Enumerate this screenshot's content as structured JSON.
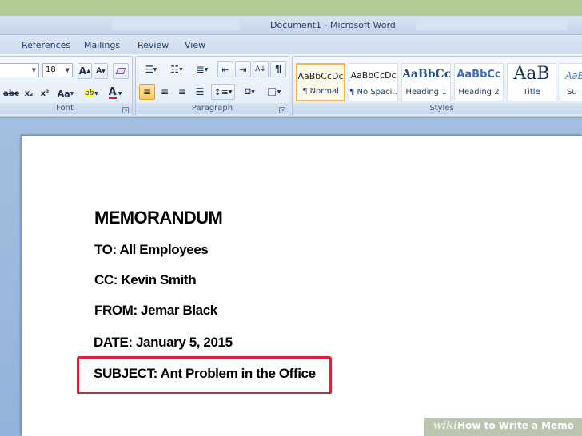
{
  "window": {
    "title": "Document1 - Microsoft Word"
  },
  "tabs": [
    "References",
    "Mailings",
    "Review",
    "View"
  ],
  "ribbon": {
    "font": {
      "size_value": "18",
      "grow_label": "A",
      "shrink_label": "A",
      "strike_label": "abc",
      "subscript_label": "x₂",
      "superscript_label": "x²",
      "case_label": "Aa",
      "highlight_label": "ab",
      "color_label": "A",
      "group_label": "Font"
    },
    "paragraph": {
      "group_label": "Paragraph",
      "pilcrow": "¶"
    },
    "styles": {
      "group_label": "Styles",
      "items": [
        {
          "preview": "AaBbCcDc",
          "name": "¶ Normal"
        },
        {
          "preview": "AaBbCcDc",
          "name": "¶ No Spaci..."
        },
        {
          "preview": "AaBbCc",
          "name": "Heading 1"
        },
        {
          "preview": "AaBbCc",
          "name": "Heading 2"
        },
        {
          "preview": "AaB",
          "name": "Title"
        },
        {
          "preview": "AaBb",
          "name": "Su"
        }
      ]
    }
  },
  "document": {
    "title": "MEMORANDUM",
    "lines": [
      "TO: All Employees",
      "CC: Kevin Smith",
      "FROM: Jemar Black",
      "DATE: January 5, 2015",
      "SUBJECT: Ant Problem in the Office"
    ]
  },
  "watermark": {
    "wiki": "wiki",
    "rest": "How to Write a Memo"
  },
  "colors": {
    "highlight_box": "#d9253b",
    "selected_style": "#f4b64a",
    "page": "#ffffff"
  }
}
